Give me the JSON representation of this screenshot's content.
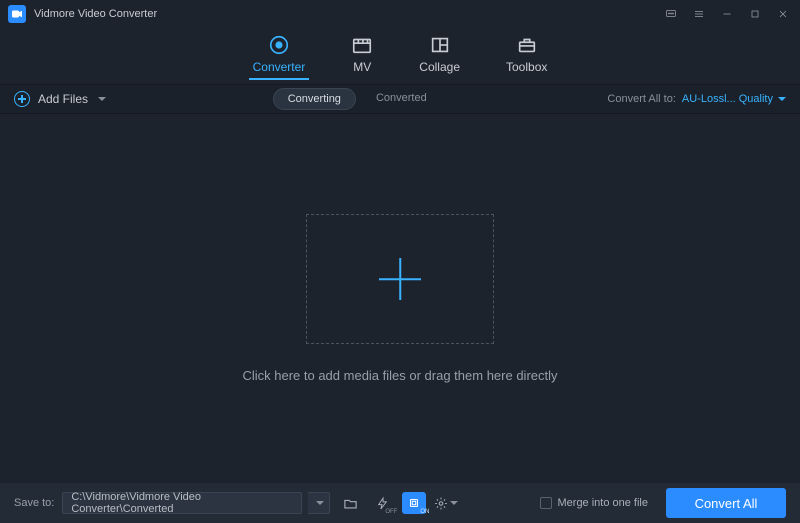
{
  "app": {
    "title": "Vidmore Video Converter"
  },
  "tabs": {
    "converter": "Converter",
    "mv": "MV",
    "collage": "Collage",
    "toolbox": "Toolbox"
  },
  "subbar": {
    "add_files": "Add Files",
    "converting": "Converting",
    "converted": "Converted",
    "convert_all_to": "Convert All to:",
    "format": "AU-Lossl... Quality"
  },
  "main": {
    "hint": "Click here to add media files or drag them here directly"
  },
  "bottom": {
    "save_to": "Save to:",
    "path": "C:\\Vidmore\\Vidmore Video Converter\\Converted",
    "merge": "Merge into one file",
    "convert_all": "Convert All",
    "off_badge": "OFF",
    "on_badge": "ON"
  }
}
